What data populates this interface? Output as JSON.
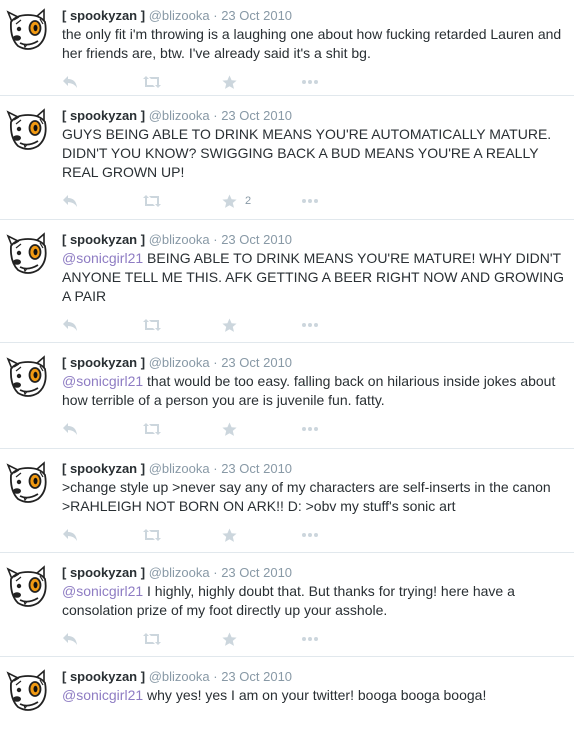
{
  "tweets": [
    {
      "name": "[ spookyzan ]",
      "handle": "@blizooka",
      "sep": "·",
      "time": "23 Oct 2010",
      "mention": "",
      "text": "the only fit i'm throwing is a laughing one about how fucking retarded Lauren and her friends are, btw. I've already said it's a shit bg.",
      "favorites": ""
    },
    {
      "name": "[ spookyzan ]",
      "handle": "@blizooka",
      "sep": "·",
      "time": "23 Oct 2010",
      "mention": "",
      "text": "GUYS BEING ABLE TO DRINK MEANS YOU'RE AUTOMATICALLY MATURE. DIDN'T YOU KNOW? SWIGGING BACK A BUD MEANS YOU'RE A REALLY REAL GROWN UP!",
      "favorites": "2"
    },
    {
      "name": "[ spookyzan ]",
      "handle": "@blizooka",
      "sep": "·",
      "time": "23 Oct 2010",
      "mention": "@sonicgirl21",
      "text": " BEING ABLE TO DRINK MEANS YOU'RE MATURE! WHY DIDN'T ANYONE TELL ME THIS. AFK GETTING A BEER RIGHT NOW AND GROWING A PAIR",
      "favorites": ""
    },
    {
      "name": "[ spookyzan ]",
      "handle": "@blizooka",
      "sep": "·",
      "time": "23 Oct 2010",
      "mention": "@sonicgirl21",
      "text": " that would be too easy. falling back on hilarious inside jokes about how terrible of a person you are is juvenile fun. fatty.",
      "favorites": ""
    },
    {
      "name": "[ spookyzan ]",
      "handle": "@blizooka",
      "sep": "·",
      "time": "23 Oct 2010",
      "mention": "",
      "text": ">change style up >never say any of my characters are self-inserts in the canon >RAHLEIGH NOT BORN ON ARK!! D: >obv my stuff's sonic art",
      "favorites": ""
    },
    {
      "name": "[ spookyzan ]",
      "handle": "@blizooka",
      "sep": "·",
      "time": "23 Oct 2010",
      "mention": "@sonicgirl21",
      "text": " I highly, highly doubt that. But thanks for trying! here have a consolation prize of my foot directly up your asshole.",
      "favorites": ""
    },
    {
      "name": "[ spookyzan ]",
      "handle": "@blizooka",
      "sep": "·",
      "time": "23 Oct 2010",
      "mention": "@sonicgirl21",
      "text": " why yes! yes I am on your twitter! booga booga booga!",
      "favorites": ""
    }
  ],
  "icons": {
    "avatar": "cartoon-dog-avatar",
    "reply": "reply-arrow-icon",
    "retweet": "retweet-icon",
    "favorite": "star-icon",
    "more": "more-dots-icon"
  },
  "colors": {
    "mention": "#8e7cc3",
    "meta": "#8899a6",
    "icon": "#ccd6dd",
    "divider": "#e1e8ed"
  }
}
